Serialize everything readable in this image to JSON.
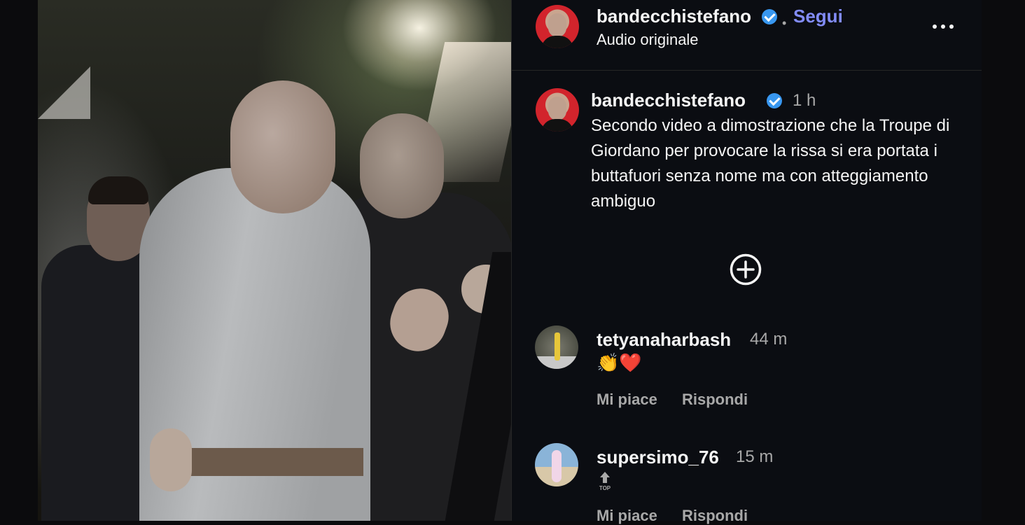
{
  "post": {
    "author": "bandecchistefano",
    "follow_label": "Segui",
    "separator": "•",
    "audio": "Audio originale",
    "caption_time": "1 h",
    "caption": "Secondo video a dimostrazione che la Troupe di Giordano per provocare la rissa si era portata i buttafuori senza nome ma con atteggiamento ambiguo"
  },
  "comments": [
    {
      "username": "tetyanaharbash",
      "time": "44 m",
      "text": "👏❤️",
      "like_label": "Mi piace",
      "reply_label": "Rispondi"
    },
    {
      "username": "supersimo_76",
      "time": "15 m",
      "text": "",
      "like_label": "Mi piace",
      "reply_label": "Rispondi"
    }
  ],
  "colors": {
    "accent": "#828cf8",
    "verified": "#3897f0",
    "background": "#0b0d12",
    "muted": "#a8a8a8"
  },
  "icons": {
    "more": "more-horizontal-icon",
    "verified": "verified-badge-icon",
    "add": "plus-circle-icon",
    "top": "top-arrow-icon"
  }
}
